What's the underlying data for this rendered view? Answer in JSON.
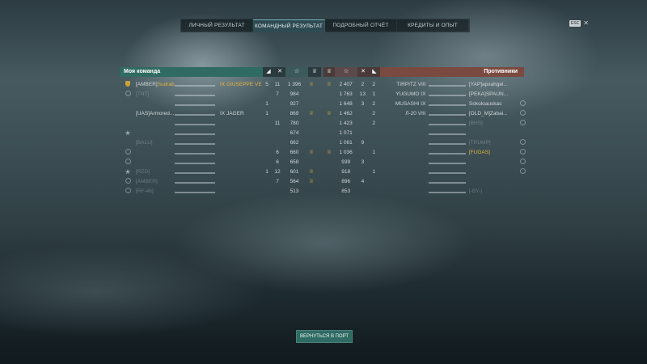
{
  "tabs": [
    {
      "label": "ЛИЧНЫЙ РЕЗУЛЬТАТ"
    },
    {
      "label": "КОМАНДНЫЙ РЕЗУЛЬТАТ"
    },
    {
      "label": "ПОДРОБНЫЙ ОТЧЁТ"
    },
    {
      "label": "КРЕДИТЫ И ОПЫТ"
    }
  ],
  "esc_label": "ESC",
  "close_glyph": "✕",
  "my_team": {
    "title": "Моя команда",
    "col_icons": [
      "ship-kill-icon",
      "plane-kill-icon",
      "star-icon",
      "laurel-icon"
    ],
    "rows": [
      {
        "clan": "[AMBER]",
        "player": "Sudrabs",
        "tier": "IX",
        "ship": "GIUSEPPE VERDI",
        "kills": "5",
        "planes": "11",
        "xp": "1 396",
        "laurel": true,
        "highlight": true,
        "icon": "level",
        "dim": false
      },
      {
        "clan": "[TNT]",
        "player": "",
        "tier": "",
        "ship": "",
        "kills": "",
        "planes": "7",
        "xp": "984",
        "laurel": false,
        "highlight": false,
        "icon": "circle",
        "dim": true
      },
      {
        "clan": "",
        "player": "",
        "tier": "",
        "ship": "",
        "kills": "1",
        "planes": "",
        "xp": "927",
        "laurel": false,
        "highlight": false,
        "icon": "none",
        "dim": true
      },
      {
        "clan": "[UAS]",
        "player": "Armored...",
        "tier": "IX",
        "ship": "JÄGER",
        "kills": "1",
        "planes": "",
        "xp": "869",
        "laurel": true,
        "highlight": false,
        "icon": "none",
        "dim": false
      },
      {
        "clan": "",
        "player": "",
        "tier": "",
        "ship": "",
        "kills": "",
        "planes": "11",
        "xp": "780",
        "laurel": false,
        "highlight": false,
        "icon": "none",
        "dim": true
      },
      {
        "clan": "",
        "player": "",
        "tier": "",
        "ship": "",
        "kills": "",
        "planes": "",
        "xp": "674",
        "laurel": false,
        "highlight": false,
        "icon": "star",
        "dim": true
      },
      {
        "clan": "[BALU]",
        "player": "",
        "tier": "",
        "ship": "",
        "kills": "",
        "planes": "",
        "xp": "662",
        "laurel": false,
        "highlight": false,
        "icon": "none",
        "dim": true
      },
      {
        "clan": "",
        "player": "",
        "tier": "",
        "ship": "",
        "kills": "",
        "planes": "6",
        "xp": "660",
        "laurel": true,
        "highlight": false,
        "icon": "circle",
        "dim": true
      },
      {
        "clan": "",
        "player": "",
        "tier": "",
        "ship": "",
        "kills": "",
        "planes": "6",
        "xp": "658",
        "laurel": false,
        "highlight": false,
        "icon": "circle",
        "dim": true
      },
      {
        "clan": "[RZD]",
        "player": "",
        "tier": "",
        "ship": "",
        "kills": "1",
        "planes": "12",
        "xp": "601",
        "laurel": true,
        "highlight": false,
        "icon": "star",
        "dim": true
      },
      {
        "clan": "[AMBER]",
        "player": "",
        "tier": "",
        "ship": "",
        "kills": "",
        "planes": "7",
        "xp": "564",
        "laurel": true,
        "highlight": false,
        "icon": "circle",
        "dim": true
      },
      {
        "clan": "[RF-46]",
        "player": "",
        "tier": "",
        "ship": "",
        "kills": "",
        "planes": "",
        "xp": "513",
        "laurel": false,
        "highlight": false,
        "icon": "circle",
        "dim": true
      }
    ]
  },
  "enemy_team": {
    "title": "Противники",
    "rows": [
      {
        "laurel": true,
        "xp": "2 407",
        "planes": "2",
        "kills": "2",
        "ship": "TIRPITZ",
        "tier": "VIII",
        "clan": "[YAP]",
        "player": "apxahgel...",
        "icon": "none",
        "dim": false
      },
      {
        "laurel": false,
        "xp": "1 763",
        "planes": "13",
        "kills": "1",
        "ship": "YŪGUMO",
        "tier": "IX",
        "clan": "[PEKA]",
        "player": "SPAUN...",
        "icon": "none",
        "dim": false
      },
      {
        "laurel": false,
        "xp": "1 648",
        "planes": "3",
        "kills": "2",
        "ship": "MUSASHI",
        "tier": "IX",
        "clan": "",
        "player": "Sokoloauskas",
        "icon": "circle",
        "dim": false
      },
      {
        "laurel": true,
        "xp": "1 462",
        "planes": "",
        "kills": "2",
        "ship": "Л-20",
        "tier": "VIII",
        "clan": "[OLD_M]",
        "player": "Zabai...",
        "icon": "circle",
        "dim": false
      },
      {
        "laurel": false,
        "xp": "1 423",
        "planes": "",
        "kills": "2",
        "ship": "",
        "tier": "",
        "clan": "[BHS]",
        "player": "",
        "icon": "circle",
        "dim": true
      },
      {
        "laurel": false,
        "xp": "1 071",
        "planes": "",
        "kills": "",
        "ship": "",
        "tier": "",
        "clan": "",
        "player": "",
        "icon": "none",
        "dim": true
      },
      {
        "laurel": false,
        "xp": "1 061",
        "planes": "9",
        "kills": "",
        "ship": "",
        "tier": "",
        "clan": "[TRUMP]",
        "player": "",
        "icon": "circle",
        "dim": true
      },
      {
        "laurel": true,
        "xp": "1 036",
        "planes": "",
        "kills": "1",
        "ship": "",
        "tier": "",
        "clan": "[FUGAS]",
        "player": "",
        "icon": "circle",
        "dim": true
      },
      {
        "laurel": false,
        "xp": "939",
        "planes": "3",
        "kills": "",
        "ship": "",
        "tier": "",
        "clan": "",
        "player": "",
        "icon": "circle",
        "dim": true
      },
      {
        "laurel": false,
        "xp": "918",
        "planes": "",
        "kills": "1",
        "ship": "",
        "tier": "",
        "clan": "",
        "player": "",
        "icon": "circle",
        "dim": true
      },
      {
        "laurel": false,
        "xp": "896",
        "planes": "4",
        "kills": "",
        "ship": "",
        "tier": "",
        "clan": "",
        "player": "",
        "icon": "none",
        "dim": true
      },
      {
        "laurel": false,
        "xp": "853",
        "planes": "",
        "kills": "",
        "ship": "",
        "tier": "",
        "clan": "[-BY-]",
        "player": "",
        "icon": "none",
        "dim": true
      }
    ]
  },
  "return_button": "ВЕРНУТЬСЯ В ПОРТ",
  "colors": {
    "my_team": "#2f6b62",
    "enemy_team": "#7a4a40",
    "highlight": "#e3b33f"
  }
}
